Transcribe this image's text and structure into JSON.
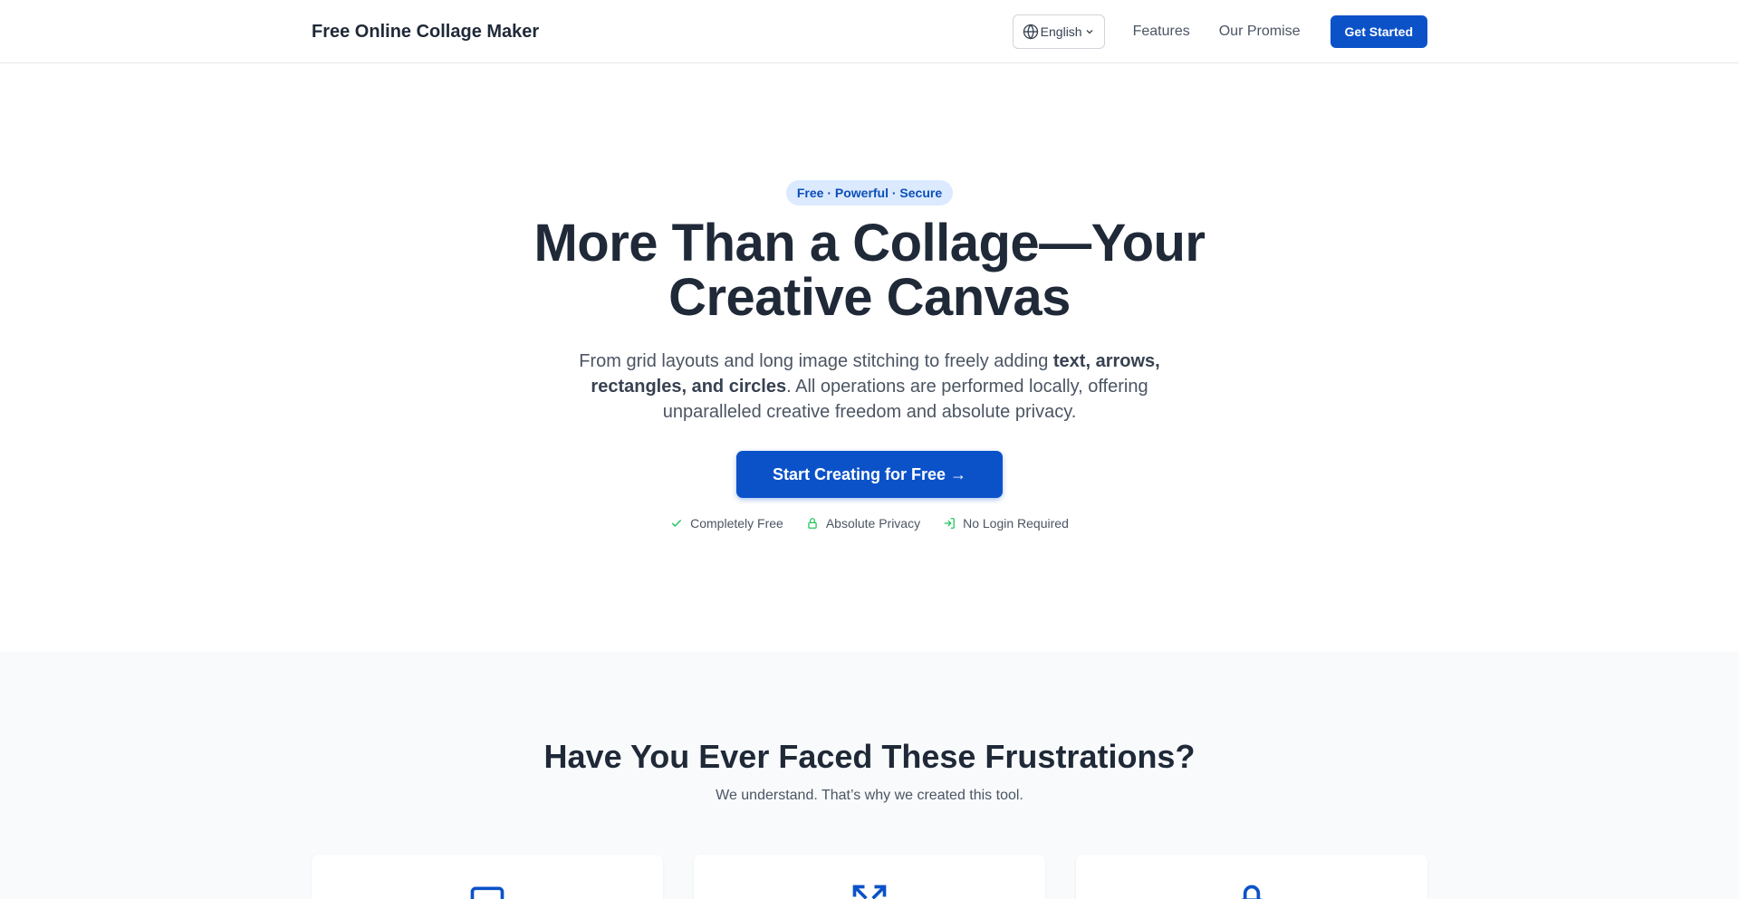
{
  "header": {
    "logo": "Free Online Collage Maker",
    "language": "English",
    "nav": {
      "features": "Features",
      "promise": "Our Promise"
    },
    "get_started": "Get Started"
  },
  "hero": {
    "badge": "Free · Powerful · Secure",
    "title": "More Than a Collage—Your Creative Canvas",
    "subtitle_prefix": "From grid layouts and long image stitching to freely adding ",
    "subtitle_bold": "text, arrows, rectangles, and circles",
    "subtitle_suffix": ". All operations are performed locally, offering unparalleled creative freedom and absolute privacy.",
    "cta": "Start Creating for Free →",
    "trust": [
      "Completely Free",
      "Absolute Privacy",
      "No Login Required"
    ]
  },
  "frustrations": {
    "title": "Have You Ever Faced These Frustrations?",
    "subtitle": "We understand. That’s why we created this tool.",
    "card_icons": [
      "monitor-icon",
      "expand-arrows-icon",
      "lock-icon"
    ]
  },
  "colors": {
    "primary": "#0b52c9",
    "badge_bg": "#dbeafe",
    "success": "#22c55e"
  }
}
